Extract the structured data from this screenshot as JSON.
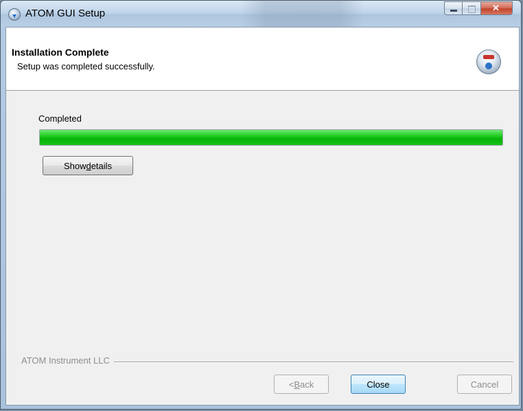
{
  "window": {
    "title": "ATOM GUI Setup",
    "icon": "setup-disc-icon"
  },
  "header": {
    "title": "Installation Complete",
    "subtitle": "Setup was completed successfully.",
    "icon": "installer-globe-icon"
  },
  "content": {
    "status_label": "Completed",
    "progress_percent": 100,
    "details_button": {
      "before": "Show ",
      "mnemonic": "d",
      "after": "etails"
    }
  },
  "footer": {
    "branding": "ATOM Instrument LLC",
    "back_button": {
      "before": "< ",
      "mnemonic": "B",
      "after": "ack",
      "enabled": false
    },
    "close_button": {
      "label": "Close",
      "default": true
    },
    "cancel_button": {
      "label": "Cancel",
      "enabled": false
    }
  },
  "colors": {
    "progress_green": "#06b406",
    "accent_blue": "#3c7fb1",
    "close_red": "#c2452d"
  }
}
